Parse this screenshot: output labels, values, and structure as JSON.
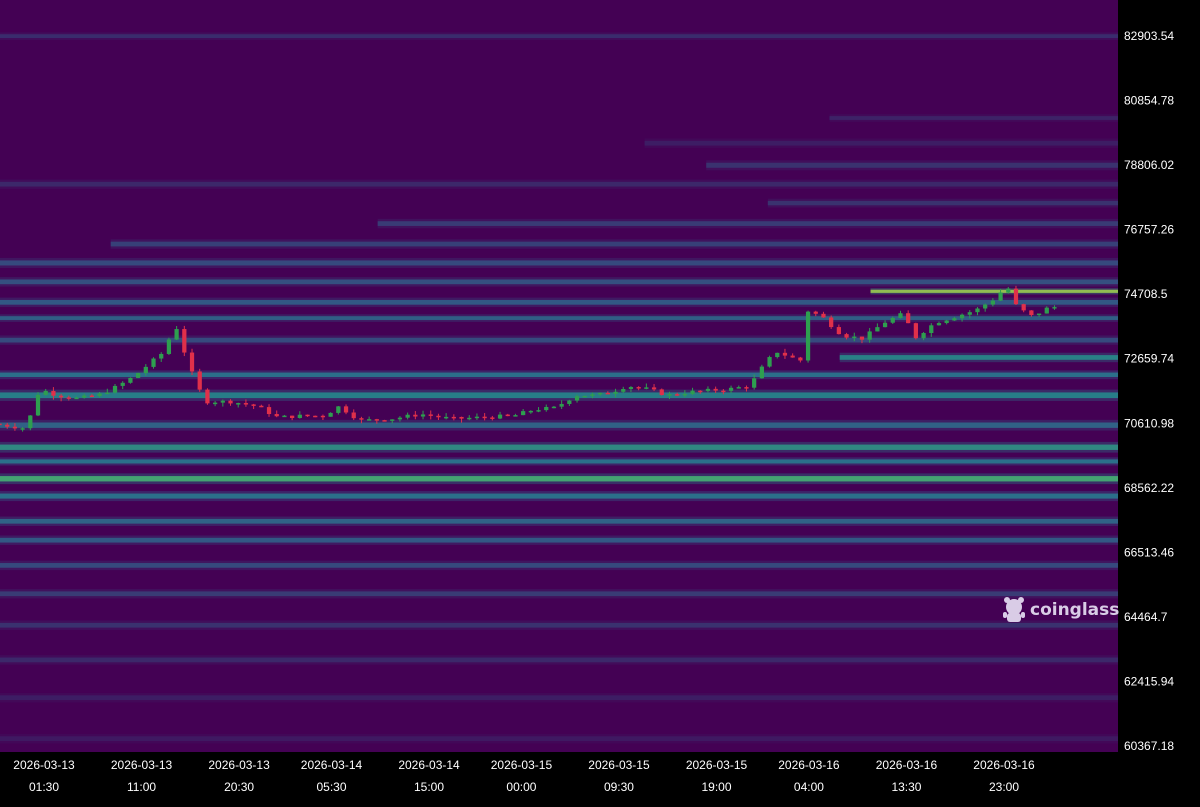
{
  "brand": {
    "name": "coinglass",
    "icon": "coinglass-mascot-icon"
  },
  "colors": {
    "background": "#000000",
    "heat_low": "#440154",
    "heat_mid": "#31688e",
    "heat_teal": "#21918c",
    "heat_green": "#5ec962",
    "heat_high": "#fde725",
    "candle_up": "#2e9e4f",
    "candle_down": "#e0304a"
  },
  "chart_data": {
    "type": "heatmap",
    "title": "",
    "xlabel": "",
    "ylabel": "",
    "x_ticks": [
      {
        "date": "2026-03-13",
        "time": "01:30"
      },
      {
        "date": "2026-03-13",
        "time": "11:00"
      },
      {
        "date": "2026-03-13",
        "time": "20:30"
      },
      {
        "date": "2026-03-14",
        "time": "05:30"
      },
      {
        "date": "2026-03-14",
        "time": "15:00"
      },
      {
        "date": "2026-03-15",
        "time": "00:00"
      },
      {
        "date": "2026-03-15",
        "time": "09:30"
      },
      {
        "date": "2026-03-15",
        "time": "19:00"
      },
      {
        "date": "2026-03-16",
        "time": "04:00"
      },
      {
        "date": "2026-03-16",
        "time": "13:30"
      },
      {
        "date": "2026-03-16",
        "time": "23:00"
      }
    ],
    "y_ticks": [
      "82903.54",
      "80854.78",
      "78806.02",
      "76757.26",
      "74708.5",
      "72659.74",
      "70610.98",
      "68562.22",
      "66513.46",
      "64464.7",
      "62415.94",
      "60367.18"
    ],
    "ylim": [
      60367.18,
      82903.54
    ],
    "xlim": [
      "2026-03-12 21:10",
      "2026-03-17 04:10"
    ],
    "price_path": [
      [
        "2026-03-12 21:10",
        70600
      ],
      [
        "2026-03-13 00:30",
        70450
      ],
      [
        "2026-03-13 01:50",
        71700
      ],
      [
        "2026-03-13 03:30",
        71500
      ],
      [
        "2026-03-13 05:30",
        71400
      ],
      [
        "2026-03-13 07:30",
        71500
      ],
      [
        "2026-03-13 09:30",
        71800
      ],
      [
        "2026-03-13 11:00",
        72100
      ],
      [
        "2026-03-13 12:30",
        72500
      ],
      [
        "2026-03-13 14:00",
        72900
      ],
      [
        "2026-03-13 15:00",
        73800
      ],
      [
        "2026-03-13 16:00",
        72800
      ],
      [
        "2026-03-13 17:00",
        71900
      ],
      [
        "2026-03-13 18:00",
        71300
      ],
      [
        "2026-03-13 20:30",
        71300
      ],
      [
        "2026-03-13 23:00",
        71150
      ],
      [
        "2026-03-14 01:00",
        70800
      ],
      [
        "2026-03-14 03:30",
        70850
      ],
      [
        "2026-03-14 05:30",
        70850
      ],
      [
        "2026-03-14 07:00",
        71150
      ],
      [
        "2026-03-14 09:00",
        70700
      ],
      [
        "2026-03-14 12:00",
        70750
      ],
      [
        "2026-03-14 15:00",
        70900
      ],
      [
        "2026-03-14 18:00",
        70750
      ],
      [
        "2026-03-14 21:00",
        70800
      ],
      [
        "2026-03-15 00:00",
        70850
      ],
      [
        "2026-03-15 02:00",
        71050
      ],
      [
        "2026-03-15 04:00",
        71100
      ],
      [
        "2026-03-15 06:00",
        71500
      ],
      [
        "2026-03-15 08:00",
        71500
      ],
      [
        "2026-03-15 09:30",
        71600
      ],
      [
        "2026-03-15 11:00",
        71800
      ],
      [
        "2026-03-15 13:00",
        71700
      ],
      [
        "2026-03-15 15:00",
        71500
      ],
      [
        "2026-03-15 17:00",
        71600
      ],
      [
        "2026-03-15 19:00",
        71650
      ],
      [
        "2026-03-15 21:00",
        71700
      ],
      [
        "2026-03-15 23:00",
        71800
      ],
      [
        "2026-03-16 00:00",
        72300
      ],
      [
        "2026-03-16 01:30",
        72900
      ],
      [
        "2026-03-16 03:00",
        72700
      ],
      [
        "2026-03-16 04:00",
        72600
      ],
      [
        "2026-03-16 04:30",
        74200
      ],
      [
        "2026-03-16 06:00",
        74000
      ],
      [
        "2026-03-16 08:00",
        73400
      ],
      [
        "2026-03-16 10:00",
        73300
      ],
      [
        "2026-03-16 12:00",
        73800
      ],
      [
        "2026-03-16 14:00",
        74100
      ],
      [
        "2026-03-16 15:00",
        73300
      ],
      [
        "2026-03-16 17:00",
        73800
      ],
      [
        "2026-03-16 19:00",
        74000
      ],
      [
        "2026-03-16 21:00",
        74200
      ],
      [
        "2026-03-16 23:00",
        74600
      ],
      [
        "2026-03-17 00:00",
        75000
      ],
      [
        "2026-03-17 01:00",
        74300
      ],
      [
        "2026-03-17 02:30",
        74000
      ],
      [
        "2026-03-17 04:10",
        74300
      ]
    ],
    "liquidity_bands": [
      {
        "price": 82900,
        "intensity": 0.18,
        "width": 120,
        "from": "2026-03-12 21:10"
      },
      {
        "price": 80300,
        "intensity": 0.14,
        "width": 120,
        "from": "2026-03-16 06:00"
      },
      {
        "price": 79500,
        "intensity": 0.12,
        "width": 150,
        "from": "2026-03-15 12:00"
      },
      {
        "price": 78800,
        "intensity": 0.2,
        "width": 160,
        "from": "2026-03-15 18:00"
      },
      {
        "price": 78200,
        "intensity": 0.16,
        "width": 150,
        "from": "2026-03-12 21:10"
      },
      {
        "price": 77600,
        "intensity": 0.2,
        "width": 140,
        "from": "2026-03-16 00:00"
      },
      {
        "price": 76950,
        "intensity": 0.24,
        "width": 150,
        "from": "2026-03-14 10:00"
      },
      {
        "price": 76300,
        "intensity": 0.26,
        "width": 150,
        "from": "2026-03-13 08:00"
      },
      {
        "price": 75700,
        "intensity": 0.3,
        "width": 160,
        "from": "2026-03-12 21:10"
      },
      {
        "price": 75100,
        "intensity": 0.32,
        "width": 150,
        "from": "2026-03-12 21:10"
      },
      {
        "price": 74800,
        "intensity": 0.95,
        "width": 100,
        "from": "2026-03-16 10:00"
      },
      {
        "price": 74450,
        "intensity": 0.36,
        "width": 150,
        "from": "2026-03-12 21:10"
      },
      {
        "price": 73950,
        "intensity": 0.4,
        "width": 120,
        "from": "2026-03-12 21:10"
      },
      {
        "price": 73250,
        "intensity": 0.3,
        "width": 150,
        "from": "2026-03-12 21:10"
      },
      {
        "price": 72700,
        "intensity": 0.62,
        "width": 150,
        "from": "2026-03-16 07:00"
      },
      {
        "price": 72150,
        "intensity": 0.5,
        "width": 140,
        "from": "2026-03-12 21:10"
      },
      {
        "price": 71500,
        "intensity": 0.6,
        "width": 180,
        "from": "2026-03-12 21:10"
      },
      {
        "price": 70550,
        "intensity": 0.42,
        "width": 170,
        "from": "2026-03-12 21:10"
      },
      {
        "price": 69850,
        "intensity": 0.66,
        "width": 170,
        "from": "2026-03-12 21:10"
      },
      {
        "price": 69400,
        "intensity": 0.5,
        "width": 130,
        "from": "2026-03-12 21:10"
      },
      {
        "price": 68850,
        "intensity": 0.8,
        "width": 170,
        "from": "2026-03-12 21:10"
      },
      {
        "price": 68300,
        "intensity": 0.5,
        "width": 160,
        "from": "2026-03-12 21:10"
      },
      {
        "price": 67500,
        "intensity": 0.42,
        "width": 150,
        "from": "2026-03-12 21:10"
      },
      {
        "price": 66900,
        "intensity": 0.36,
        "width": 150,
        "from": "2026-03-12 21:10"
      },
      {
        "price": 66100,
        "intensity": 0.3,
        "width": 150,
        "from": "2026-03-12 21:10"
      },
      {
        "price": 65200,
        "intensity": 0.24,
        "width": 150,
        "from": "2026-03-12 21:10"
      },
      {
        "price": 64200,
        "intensity": 0.2,
        "width": 150,
        "from": "2026-03-12 21:10"
      },
      {
        "price": 63100,
        "intensity": 0.16,
        "width": 150,
        "from": "2026-03-12 21:10"
      },
      {
        "price": 61900,
        "intensity": 0.12,
        "width": 150,
        "from": "2026-03-12 21:10"
      },
      {
        "price": 60600,
        "intensity": 0.1,
        "width": 150,
        "from": "2026-03-12 21:10"
      }
    ],
    "candle_interval_minutes": 45,
    "grid": false,
    "legend": "none"
  }
}
